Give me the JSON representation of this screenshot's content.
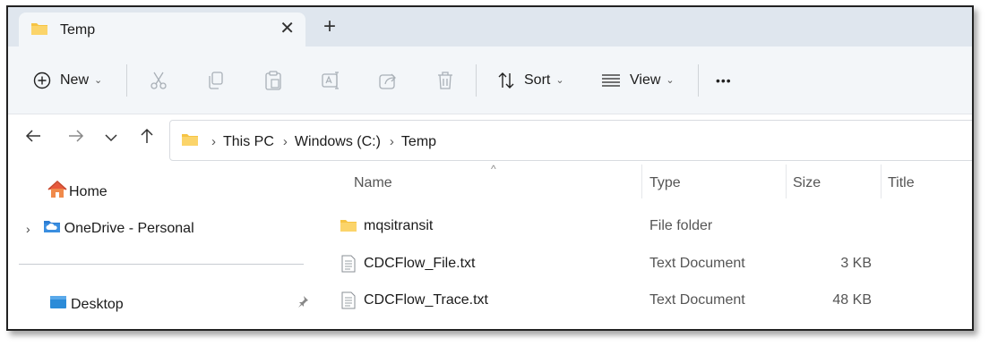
{
  "window": {
    "tab_title": "Temp",
    "close_symbol": "✕",
    "new_tab_symbol": "+"
  },
  "toolbar": {
    "new_label": "New",
    "sort_label": "Sort",
    "view_label": "View",
    "more_symbol": "•••",
    "icons": [
      "plus-circle-icon",
      "cut-icon",
      "copy-icon",
      "paste-icon",
      "rename-icon",
      "share-icon",
      "delete-icon",
      "sort-icon",
      "view-icon"
    ]
  },
  "address": {
    "breadcrumbs": [
      "This PC",
      "Windows (C:)",
      "Temp"
    ],
    "separator": "›"
  },
  "nav": {
    "items": [
      {
        "label": "Home",
        "icon": "home-icon"
      },
      {
        "label": "OneDrive - Personal",
        "icon": "cloud-folder-icon"
      },
      {
        "label": "Desktop",
        "icon": "desktop-folder-icon"
      }
    ]
  },
  "filelist": {
    "columns": [
      "Name",
      "Type",
      "Size",
      "Title"
    ],
    "sorted_column": "Name",
    "rows": [
      {
        "name": "mqsitransit",
        "type": "File folder",
        "size": "",
        "icon": "folder-icon"
      },
      {
        "name": "CDCFlow_File.txt",
        "type": "Text Document",
        "size": "3 KB",
        "icon": "text-file-icon"
      },
      {
        "name": "CDCFlow_Trace.txt",
        "type": "Text Document",
        "size": "48 KB",
        "icon": "text-file-icon"
      }
    ]
  },
  "colors": {
    "folder": "#f6c444",
    "tabstrip": "#dfe6ee",
    "toolbar": "#f3f6f9",
    "accent_blue": "#2b7cd3"
  }
}
